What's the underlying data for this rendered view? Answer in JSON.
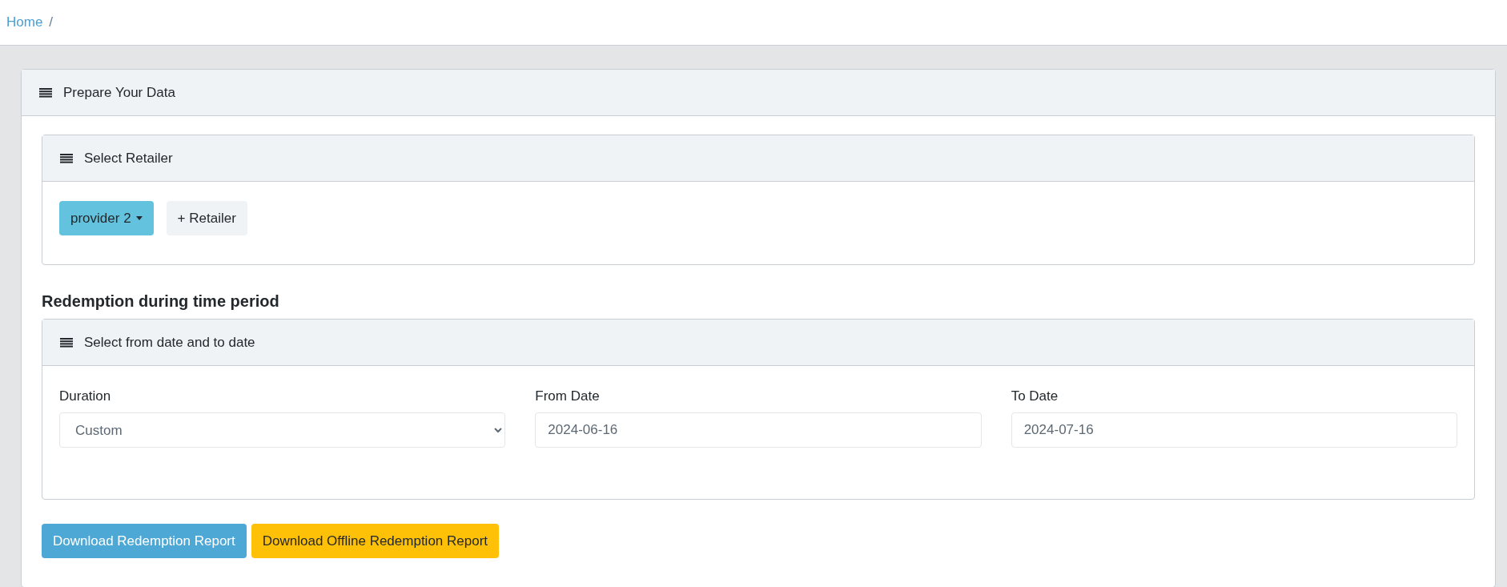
{
  "breadcrumb": [
    {
      "label": "Home",
      "separator": "/"
    }
  ],
  "panel": {
    "title": "Prepare Your Data",
    "retailer_card": {
      "title": "Select Retailer",
      "retailers": [
        {
          "label": "provider 2",
          "kind": "dropdown"
        },
        {
          "label": "+ Retailer",
          "kind": "add"
        }
      ]
    },
    "section_heading": "Redemption during time period",
    "date_card": {
      "title": "Select from date and to date",
      "fields": [
        {
          "label": "Duration",
          "kind": "select",
          "value": "Custom"
        },
        {
          "label": "From Date",
          "kind": "input",
          "value": "2024-06-16"
        },
        {
          "label": "To Date",
          "kind": "input",
          "value": "2024-07-16"
        }
      ]
    },
    "buttons": [
      {
        "label": "Download Redemption Report",
        "kind": "primary"
      },
      {
        "label": "Download Offline Redemption Report",
        "kind": "warning"
      }
    ]
  }
}
